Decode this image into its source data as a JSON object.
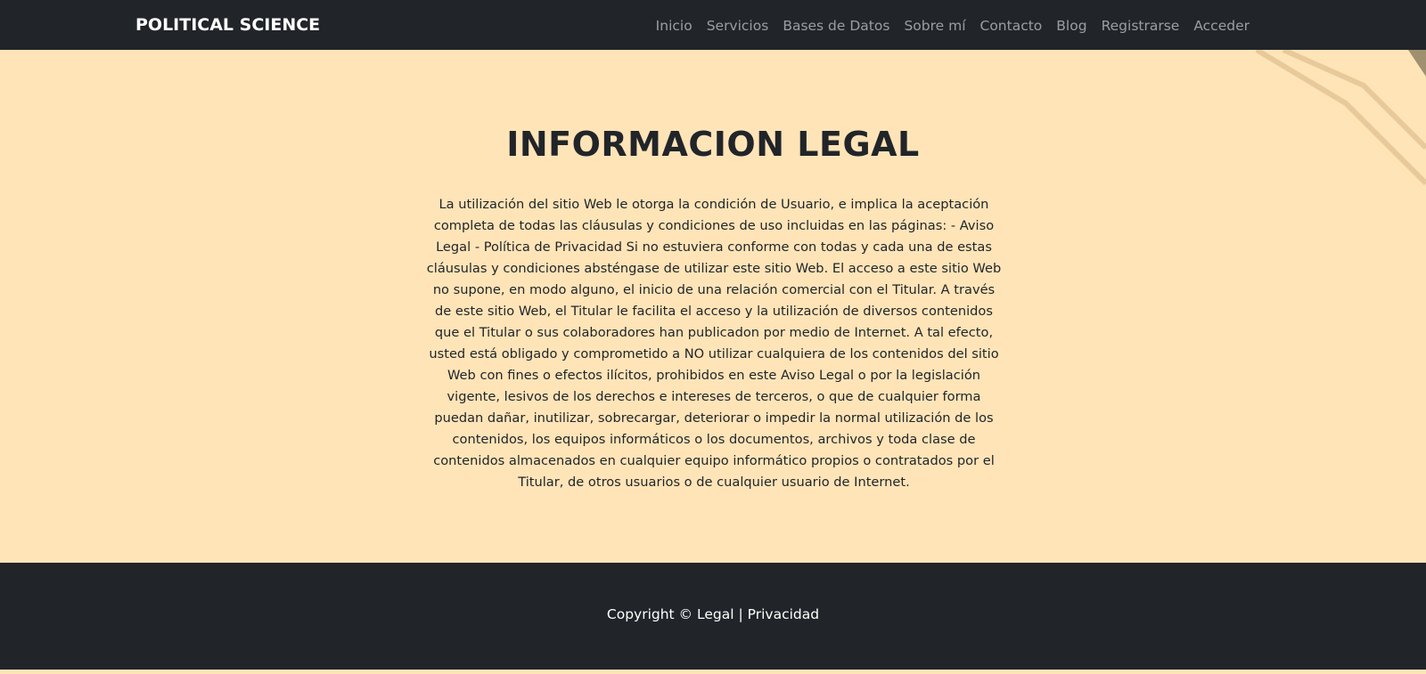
{
  "navbar": {
    "brand": "POLITICAL SCIENCE",
    "links": [
      "Inicio",
      "Servicios",
      "Bases de Datos",
      "Sobre mí",
      "Contacto",
      "Blog",
      "Registrarse",
      "Acceder"
    ]
  },
  "main": {
    "title": "INFORMACION LEGAL",
    "body": "La utilización del sitio Web le otorga la condición de Usuario, e implica la aceptación completa de todas las cláusulas y condiciones de uso incluidas en las páginas: - Aviso Legal - Política de Privacidad Si no estuviera conforme con todas y cada una de estas cláusulas y condiciones absténgase de utilizar este sitio Web. El acceso a este sitio Web no supone, en modo alguno, el inicio de una relación comercial con el Titular. A través de este sitio Web, el Titular le facilita el acceso y la utilización de diversos contenidos que el Titular o sus colaboradores han publicadon por medio de Internet. A tal efecto, usted está obligado y comprometido a NO utilizar cualquiera de los contenidos del sitio Web con fines o efectos ilícitos, prohibidos en este Aviso Legal o por la legislación vigente, lesivos de los derechos e intereses de terceros, o que de cualquier forma puedan dañar, inutilizar, sobrecargar, deteriorar o impedir la normal utilización de los contenidos, los equipos informáticos o los documentos, archivos y toda clase de contenidos almacenados en cualquier equipo informático propios o contratados por el Titular, de otros usuarios o de cualquier usuario de Internet."
  },
  "footer": {
    "copyright": "Copyright ©",
    "legal_link": "Legal",
    "separator": "|",
    "privacy_link": "Privacidad"
  },
  "colors": {
    "navbar_bg": "#212529",
    "page_bg": "#ffe4b8",
    "text": "#212529"
  }
}
